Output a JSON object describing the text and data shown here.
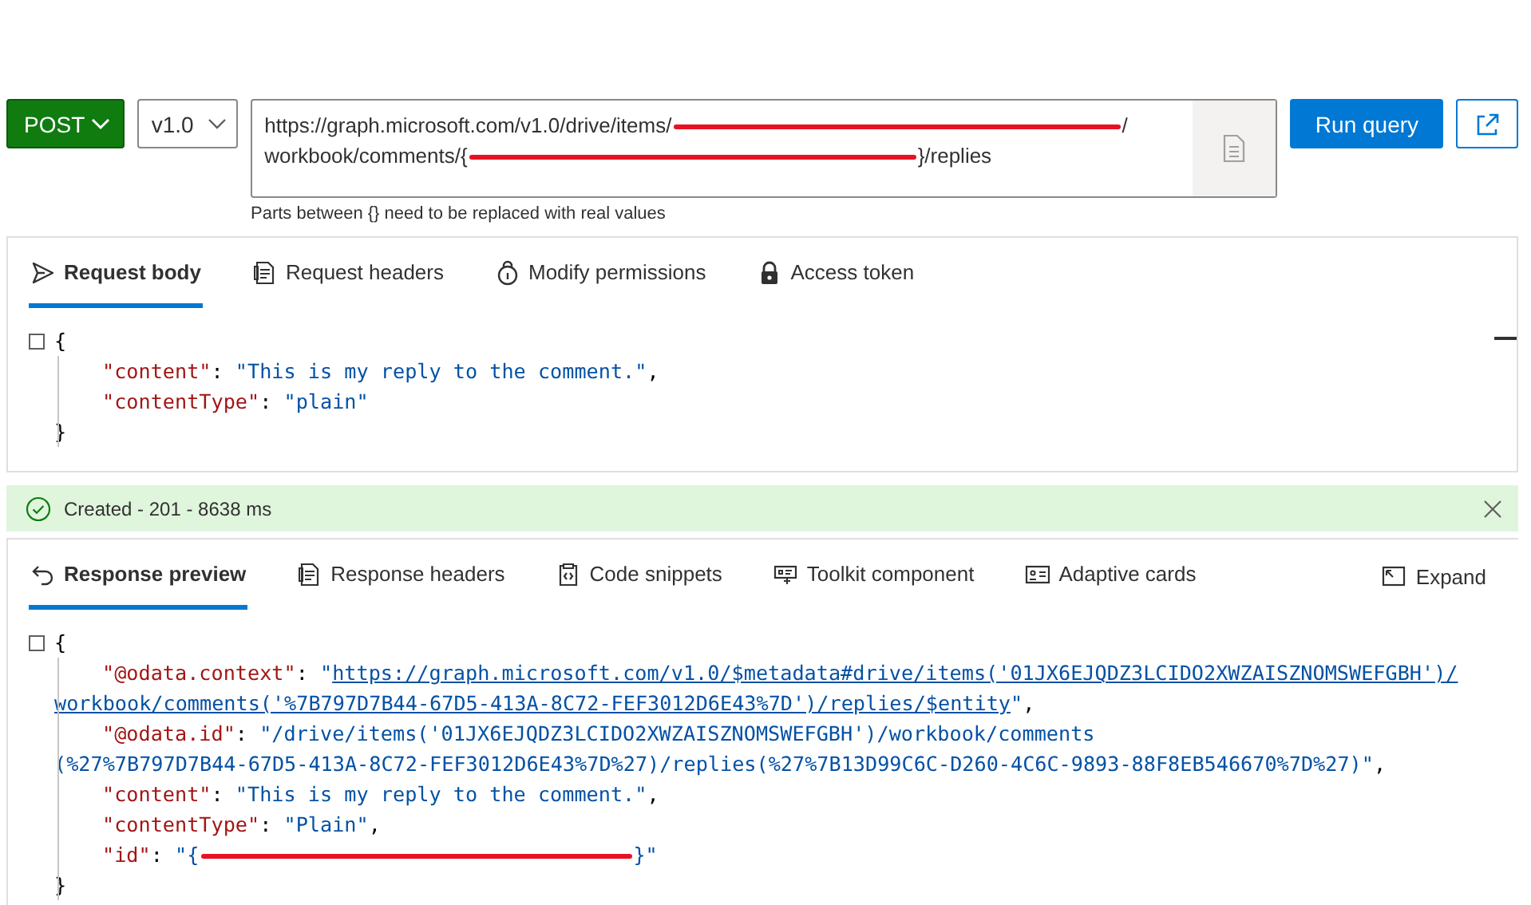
{
  "query_bar": {
    "method": "POST",
    "version": "v1.0",
    "url_lines": [
      [
        {
          "kind": "text",
          "text": "https://graph.microsoft.com/v1.0/drive/items/"
        },
        {
          "kind": "redaction"
        },
        {
          "kind": "text",
          "text": "/"
        }
      ],
      [
        {
          "kind": "text",
          "text": "workbook/comments/{"
        },
        {
          "kind": "redaction"
        },
        {
          "kind": "text",
          "text": "}/replies"
        }
      ]
    ],
    "run_button": "Run query",
    "hint": "Parts between {} need to be replaced with real values"
  },
  "request": {
    "tabs": [
      {
        "label": "Request body",
        "selected": true
      },
      {
        "label": "Request headers",
        "selected": false
      },
      {
        "label": "Modify permissions",
        "selected": false
      },
      {
        "label": "Access token",
        "selected": false
      }
    ],
    "code_lines": [
      {
        "indented": false,
        "tokens": [
          {
            "kind": "punct",
            "text": "{"
          }
        ]
      },
      {
        "indented": true,
        "tokens": [
          {
            "kind": "key",
            "text": "\"content\""
          },
          {
            "kind": "punct",
            "text": ": "
          },
          {
            "kind": "string",
            "text": "\"This is my reply to the comment.\""
          },
          {
            "kind": "punct",
            "text": ","
          }
        ]
      },
      {
        "indented": true,
        "tokens": [
          {
            "kind": "key",
            "text": "\"contentType\""
          },
          {
            "kind": "punct",
            "text": ": "
          },
          {
            "kind": "string",
            "text": "\"plain\""
          }
        ]
      },
      {
        "indented": false,
        "tokens": [
          {
            "kind": "punct",
            "text": "}"
          }
        ]
      }
    ]
  },
  "status": {
    "kind": "success",
    "text": "Created - 201 - 8638 ms"
  },
  "response": {
    "tabs": [
      {
        "label": "Response preview",
        "selected": true
      },
      {
        "label": "Response headers",
        "selected": false
      },
      {
        "label": "Code snippets",
        "selected": false
      },
      {
        "label": "Toolkit component",
        "selected": false
      },
      {
        "label": "Adaptive cards",
        "selected": false
      }
    ],
    "expand": "Expand",
    "code_lines": [
      {
        "indented": false,
        "tokens": [
          {
            "kind": "punct",
            "text": "{"
          }
        ]
      },
      {
        "indented": true,
        "tokens": [
          {
            "kind": "key",
            "text": "\"@odata.context\""
          },
          {
            "kind": "punct",
            "text": ": "
          },
          {
            "kind": "string",
            "text": "\""
          },
          {
            "kind": "link",
            "text": "https://graph.microsoft.com/v1.0/$metadata#drive/items('01JX6EJQDZ3LCIDO2XWZAISZNOMSWEFGBH')/"
          }
        ]
      },
      {
        "indented": false,
        "tokens": [
          {
            "kind": "link",
            "text": "workbook/comments('%7B797D7B44-67D5-413A-8C72-FEF3012D6E43%7D')/replies/$entity"
          },
          {
            "kind": "string",
            "text": "\""
          },
          {
            "kind": "punct",
            "text": ","
          }
        ]
      },
      {
        "indented": true,
        "tokens": [
          {
            "kind": "key",
            "text": "\"@odata.id\""
          },
          {
            "kind": "punct",
            "text": ": "
          },
          {
            "kind": "string",
            "text": "\"/drive/items('01JX6EJQDZ3LCIDO2XWZAISZNOMSWEFGBH')/workbook/comments"
          }
        ]
      },
      {
        "indented": false,
        "tokens": [
          {
            "kind": "string",
            "text": "(%27%7B797D7B44-67D5-413A-8C72-FEF3012D6E43%7D%27)/replies(%27%7B13D99C6C-D260-4C6C-9893-88F8EB546670%7D%27)\""
          },
          {
            "kind": "punct",
            "text": ","
          }
        ]
      },
      {
        "indented": true,
        "tokens": [
          {
            "kind": "key",
            "text": "\"content\""
          },
          {
            "kind": "punct",
            "text": ": "
          },
          {
            "kind": "string",
            "text": "\"This is my reply to the comment.\""
          },
          {
            "kind": "punct",
            "text": ","
          }
        ]
      },
      {
        "indented": true,
        "tokens": [
          {
            "kind": "key",
            "text": "\"contentType\""
          },
          {
            "kind": "punct",
            "text": ": "
          },
          {
            "kind": "string",
            "text": "\"Plain\""
          },
          {
            "kind": "punct",
            "text": ","
          }
        ]
      },
      {
        "indented": true,
        "tokens": [
          {
            "kind": "key",
            "text": "\"id\""
          },
          {
            "kind": "punct",
            "text": ": "
          },
          {
            "kind": "string",
            "text": "\"{"
          },
          {
            "kind": "redaction"
          },
          {
            "kind": "string",
            "text": "}\""
          }
        ]
      },
      {
        "indented": false,
        "tokens": [
          {
            "kind": "punct",
            "text": "}"
          }
        ]
      }
    ]
  }
}
